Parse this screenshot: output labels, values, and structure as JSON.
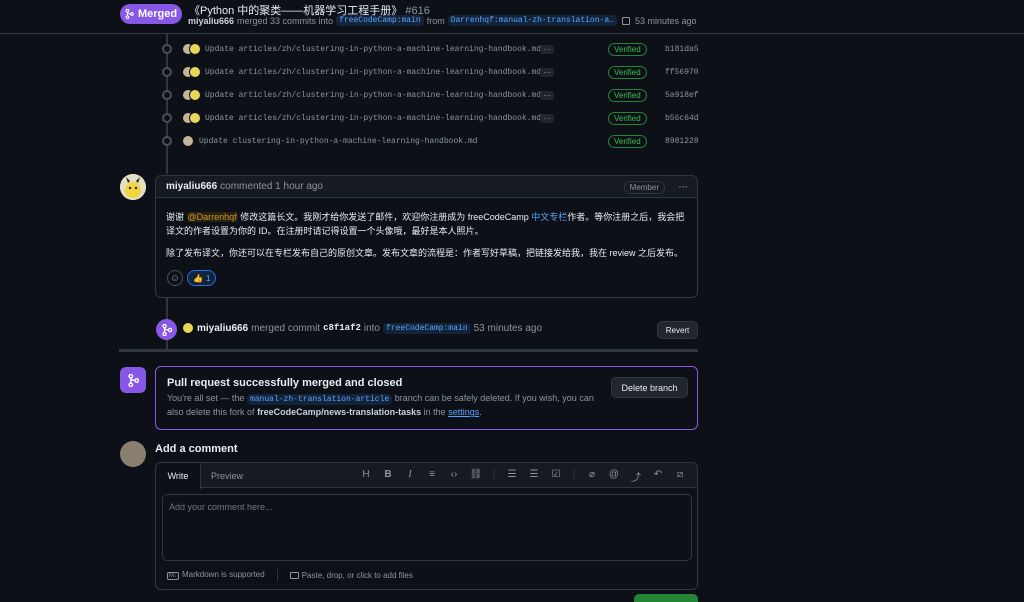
{
  "header": {
    "status": "Merged",
    "title": "《Python 中的聚类——机器学习工程手册》",
    "number": "#616",
    "author": "miyaliu666",
    "merged_text": "merged 33 commits into",
    "base_branch": "freeCodeCamp:main",
    "from_text": "from",
    "head_branch": "Darrenhqf:manual-zh-translation-a…",
    "time": "53 minutes ago"
  },
  "commits": [
    {
      "message": "Update articles/zh/clustering-in-python-a-machine-learning-handbook.md",
      "status": "Verified",
      "sha": "b181da5"
    },
    {
      "message": "Update articles/zh/clustering-in-python-a-machine-learning-handbook.md",
      "status": "Verified",
      "sha": "ff56970"
    },
    {
      "message": "Update articles/zh/clustering-in-python-a-machine-learning-handbook.md",
      "status": "Verified",
      "sha": "5a918ef"
    },
    {
      "message": "Update articles/zh/clustering-in-python-a-machine-learning-handbook.md",
      "status": "Verified",
      "sha": "b56c64d"
    },
    {
      "message": "Update clustering-in-python-a-machine-learning-handbook.md",
      "status": "Verified",
      "sha": "8981228"
    }
  ],
  "comment": {
    "author": "miyaliu666",
    "action": "commented 1 hour ago",
    "role": "Member",
    "p1_a": "谢谢 ",
    "mention": "@Darrenhqf",
    "p1_b": " 修改这篇长文。我刚才给你发送了邮件，欢迎你注册成为 freeCodeCamp ",
    "link": "中文专栏",
    "p1_c": "作者。等你注册之后，我会把译文的作者设置为你的 ID。在注册时请记得设置一个头像哦，最好是本人照片。",
    "p2": "除了发布译文，你还可以在专栏发布自己的原创文章。发布文章的流程是：作者写好草稿，把链接发给我，我在 review 之后发布。",
    "reaction_count": "1"
  },
  "merge_event": {
    "author": "miyaliu666",
    "text": "merged commit",
    "sha": "c8f1af2",
    "into": "into",
    "branch": "freeCodeCamp:main",
    "time": "53 minutes ago",
    "revert_label": "Revert"
  },
  "merged_box": {
    "title": "Pull request successfully merged and closed",
    "t1": "You're all set — the",
    "branch": "manual-zh-translation-article",
    "t2": "branch can be safely deleted. If you wish, you can also delete this fork of",
    "fork": "freeCodeCamp/news-translation-tasks",
    "t3": "in the",
    "settings": "settings",
    "t4": ".",
    "delete_label": "Delete branch"
  },
  "add_comment": {
    "title": "Add a comment",
    "tab_write": "Write",
    "tab_preview": "Preview",
    "placeholder": "Add your comment here...",
    "markdown_note": "Markdown is supported",
    "attach_note": "Paste, drop, or click to add files"
  }
}
